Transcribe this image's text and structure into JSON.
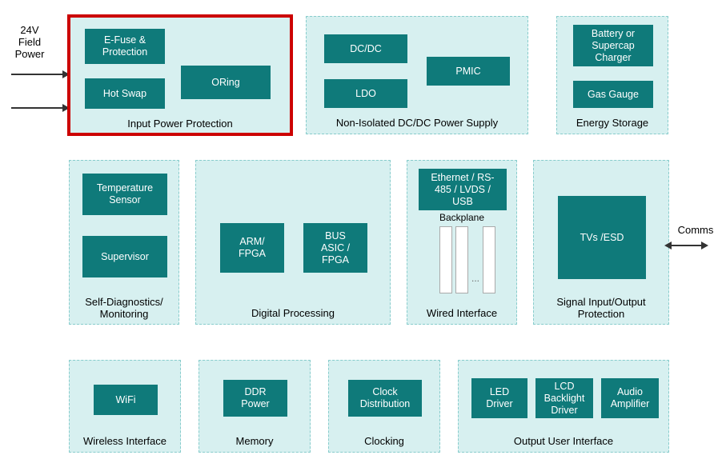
{
  "external_labels": {
    "power_in": "24V\nField\nPower",
    "comms": "Comms"
  },
  "groups": {
    "input_power": {
      "label": "Input Power Protection",
      "blocks": {
        "efuse": "E-Fuse &\nProtection",
        "hotswap": "Hot Swap",
        "oring": "ORing"
      }
    },
    "dcdc": {
      "label": "Non-Isolated DC/DC Power Supply",
      "blocks": {
        "dcdc": "DC/DC",
        "ldo": "LDO",
        "pmic": "PMIC"
      }
    },
    "energy": {
      "label": "Energy Storage",
      "blocks": {
        "charger": "Battery or\nSupercap\nCharger",
        "gas": "Gas Gauge"
      }
    },
    "selfdiag": {
      "label": "Self-Diagnostics/\nMonitoring",
      "blocks": {
        "temp": "Temperature\nSensor",
        "supervisor": "Supervisor"
      }
    },
    "dproc": {
      "label": "Digital Processing",
      "blocks": {
        "arm": "ARM/\nFPGA",
        "bus": "BUS\nASIC /\nFPGA"
      }
    },
    "wired": {
      "label": "Wired Interface",
      "blocks": {
        "eth": "Ethernet / RS-\n485 / LVDS /\nUSB"
      },
      "backplane_caption": "Backplane",
      "backplane_dots": "..."
    },
    "sigio": {
      "label": "Signal Input/Output\nProtection",
      "blocks": {
        "tvs": "TVs /ESD"
      }
    },
    "wireless": {
      "label": "Wireless Interface",
      "blocks": {
        "wifi": "WiFi"
      }
    },
    "memory": {
      "label": "Memory",
      "blocks": {
        "ddr": "DDR\nPower"
      }
    },
    "clocking": {
      "label": "Clocking",
      "blocks": {
        "clock": "Clock\nDistribution"
      }
    },
    "output_ui": {
      "label": "Output User Interface",
      "blocks": {
        "led": "LED\nDriver",
        "lcd": "LCD\nBacklight\nDriver",
        "audio": "Audio\nAmplifier"
      }
    }
  }
}
